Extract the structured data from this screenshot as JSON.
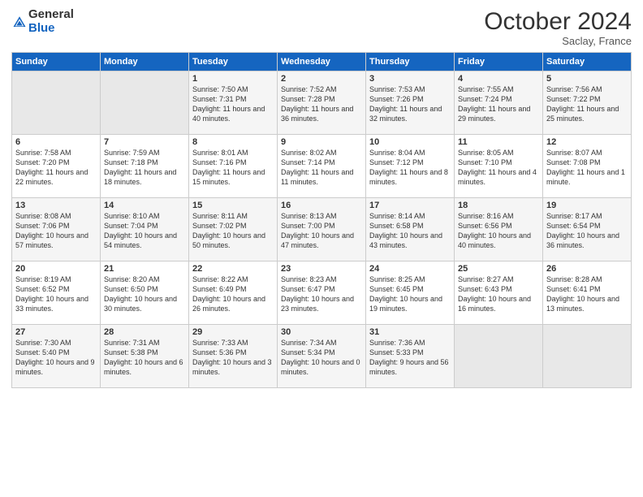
{
  "logo": {
    "general": "General",
    "blue": "Blue"
  },
  "header": {
    "month": "October 2024",
    "location": "Saclay, France"
  },
  "days_of_week": [
    "Sunday",
    "Monday",
    "Tuesday",
    "Wednesday",
    "Thursday",
    "Friday",
    "Saturday"
  ],
  "weeks": [
    [
      {
        "day": "",
        "empty": true
      },
      {
        "day": "",
        "empty": true
      },
      {
        "day": "1",
        "sunrise": "Sunrise: 7:50 AM",
        "sunset": "Sunset: 7:31 PM",
        "daylight": "Daylight: 11 hours and 40 minutes."
      },
      {
        "day": "2",
        "sunrise": "Sunrise: 7:52 AM",
        "sunset": "Sunset: 7:28 PM",
        "daylight": "Daylight: 11 hours and 36 minutes."
      },
      {
        "day": "3",
        "sunrise": "Sunrise: 7:53 AM",
        "sunset": "Sunset: 7:26 PM",
        "daylight": "Daylight: 11 hours and 32 minutes."
      },
      {
        "day": "4",
        "sunrise": "Sunrise: 7:55 AM",
        "sunset": "Sunset: 7:24 PM",
        "daylight": "Daylight: 11 hours and 29 minutes."
      },
      {
        "day": "5",
        "sunrise": "Sunrise: 7:56 AM",
        "sunset": "Sunset: 7:22 PM",
        "daylight": "Daylight: 11 hours and 25 minutes."
      }
    ],
    [
      {
        "day": "6",
        "sunrise": "Sunrise: 7:58 AM",
        "sunset": "Sunset: 7:20 PM",
        "daylight": "Daylight: 11 hours and 22 minutes."
      },
      {
        "day": "7",
        "sunrise": "Sunrise: 7:59 AM",
        "sunset": "Sunset: 7:18 PM",
        "daylight": "Daylight: 11 hours and 18 minutes."
      },
      {
        "day": "8",
        "sunrise": "Sunrise: 8:01 AM",
        "sunset": "Sunset: 7:16 PM",
        "daylight": "Daylight: 11 hours and 15 minutes."
      },
      {
        "day": "9",
        "sunrise": "Sunrise: 8:02 AM",
        "sunset": "Sunset: 7:14 PM",
        "daylight": "Daylight: 11 hours and 11 minutes."
      },
      {
        "day": "10",
        "sunrise": "Sunrise: 8:04 AM",
        "sunset": "Sunset: 7:12 PM",
        "daylight": "Daylight: 11 hours and 8 minutes."
      },
      {
        "day": "11",
        "sunrise": "Sunrise: 8:05 AM",
        "sunset": "Sunset: 7:10 PM",
        "daylight": "Daylight: 11 hours and 4 minutes."
      },
      {
        "day": "12",
        "sunrise": "Sunrise: 8:07 AM",
        "sunset": "Sunset: 7:08 PM",
        "daylight": "Daylight: 11 hours and 1 minute."
      }
    ],
    [
      {
        "day": "13",
        "sunrise": "Sunrise: 8:08 AM",
        "sunset": "Sunset: 7:06 PM",
        "daylight": "Daylight: 10 hours and 57 minutes."
      },
      {
        "day": "14",
        "sunrise": "Sunrise: 8:10 AM",
        "sunset": "Sunset: 7:04 PM",
        "daylight": "Daylight: 10 hours and 54 minutes."
      },
      {
        "day": "15",
        "sunrise": "Sunrise: 8:11 AM",
        "sunset": "Sunset: 7:02 PM",
        "daylight": "Daylight: 10 hours and 50 minutes."
      },
      {
        "day": "16",
        "sunrise": "Sunrise: 8:13 AM",
        "sunset": "Sunset: 7:00 PM",
        "daylight": "Daylight: 10 hours and 47 minutes."
      },
      {
        "day": "17",
        "sunrise": "Sunrise: 8:14 AM",
        "sunset": "Sunset: 6:58 PM",
        "daylight": "Daylight: 10 hours and 43 minutes."
      },
      {
        "day": "18",
        "sunrise": "Sunrise: 8:16 AM",
        "sunset": "Sunset: 6:56 PM",
        "daylight": "Daylight: 10 hours and 40 minutes."
      },
      {
        "day": "19",
        "sunrise": "Sunrise: 8:17 AM",
        "sunset": "Sunset: 6:54 PM",
        "daylight": "Daylight: 10 hours and 36 minutes."
      }
    ],
    [
      {
        "day": "20",
        "sunrise": "Sunrise: 8:19 AM",
        "sunset": "Sunset: 6:52 PM",
        "daylight": "Daylight: 10 hours and 33 minutes."
      },
      {
        "day": "21",
        "sunrise": "Sunrise: 8:20 AM",
        "sunset": "Sunset: 6:50 PM",
        "daylight": "Daylight: 10 hours and 30 minutes."
      },
      {
        "day": "22",
        "sunrise": "Sunrise: 8:22 AM",
        "sunset": "Sunset: 6:49 PM",
        "daylight": "Daylight: 10 hours and 26 minutes."
      },
      {
        "day": "23",
        "sunrise": "Sunrise: 8:23 AM",
        "sunset": "Sunset: 6:47 PM",
        "daylight": "Daylight: 10 hours and 23 minutes."
      },
      {
        "day": "24",
        "sunrise": "Sunrise: 8:25 AM",
        "sunset": "Sunset: 6:45 PM",
        "daylight": "Daylight: 10 hours and 19 minutes."
      },
      {
        "day": "25",
        "sunrise": "Sunrise: 8:27 AM",
        "sunset": "Sunset: 6:43 PM",
        "daylight": "Daylight: 10 hours and 16 minutes."
      },
      {
        "day": "26",
        "sunrise": "Sunrise: 8:28 AM",
        "sunset": "Sunset: 6:41 PM",
        "daylight": "Daylight: 10 hours and 13 minutes."
      }
    ],
    [
      {
        "day": "27",
        "sunrise": "Sunrise: 7:30 AM",
        "sunset": "Sunset: 5:40 PM",
        "daylight": "Daylight: 10 hours and 9 minutes."
      },
      {
        "day": "28",
        "sunrise": "Sunrise: 7:31 AM",
        "sunset": "Sunset: 5:38 PM",
        "daylight": "Daylight: 10 hours and 6 minutes."
      },
      {
        "day": "29",
        "sunrise": "Sunrise: 7:33 AM",
        "sunset": "Sunset: 5:36 PM",
        "daylight": "Daylight: 10 hours and 3 minutes."
      },
      {
        "day": "30",
        "sunrise": "Sunrise: 7:34 AM",
        "sunset": "Sunset: 5:34 PM",
        "daylight": "Daylight: 10 hours and 0 minutes."
      },
      {
        "day": "31",
        "sunrise": "Sunrise: 7:36 AM",
        "sunset": "Sunset: 5:33 PM",
        "daylight": "Daylight: 9 hours and 56 minutes."
      },
      {
        "day": "",
        "empty": true
      },
      {
        "day": "",
        "empty": true
      }
    ]
  ]
}
